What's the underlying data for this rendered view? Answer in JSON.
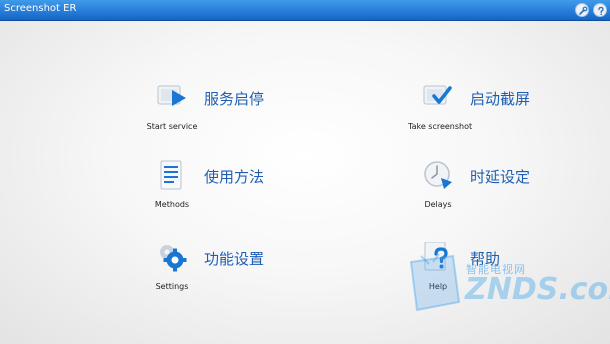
{
  "app": {
    "title": "Screenshot ER"
  },
  "toolbar": {
    "buttons": [
      {
        "icon": "tools-icon"
      },
      {
        "icon": "help-icon"
      }
    ]
  },
  "menu": {
    "start_service": {
      "caption": "Start service",
      "label": "服务启停",
      "icon": "play-icon"
    },
    "take_screenshot": {
      "caption": "Take screenshot",
      "label": "启动截屏",
      "icon": "checkmark-icon"
    },
    "methods": {
      "caption": "Methods",
      "label": "使用方法",
      "icon": "document-icon"
    },
    "delays": {
      "caption": "Delays",
      "label": "时延设定",
      "icon": "clock-icon"
    },
    "settings": {
      "caption": "Settings",
      "label": "功能设置",
      "icon": "gear-icon"
    },
    "help": {
      "caption": "Help",
      "label": "帮助",
      "icon": "help-document-icon"
    }
  },
  "watermark": {
    "sub": "智能电视网",
    "main": "ZNDS.com"
  },
  "colors": {
    "titlebar": "#1e74d8",
    "label_text": "#1f5fb3",
    "icon_blue": "#1976d2"
  }
}
